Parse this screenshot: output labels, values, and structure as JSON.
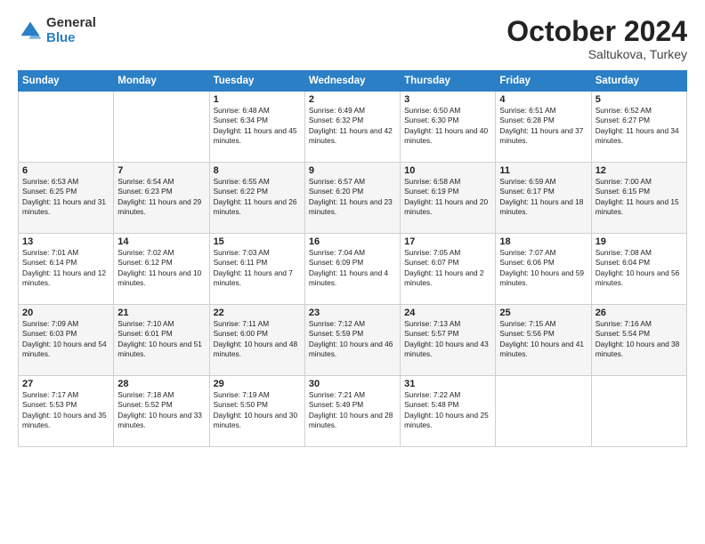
{
  "header": {
    "logo_general": "General",
    "logo_blue": "Blue",
    "month_title": "October 2024",
    "location": "Saltukova, Turkey"
  },
  "weekdays": [
    "Sunday",
    "Monday",
    "Tuesday",
    "Wednesday",
    "Thursday",
    "Friday",
    "Saturday"
  ],
  "weeks": [
    [
      {
        "day": "",
        "sunrise": "",
        "sunset": "",
        "daylight": ""
      },
      {
        "day": "",
        "sunrise": "",
        "sunset": "",
        "daylight": ""
      },
      {
        "day": "1",
        "sunrise": "Sunrise: 6:48 AM",
        "sunset": "Sunset: 6:34 PM",
        "daylight": "Daylight: 11 hours and 45 minutes."
      },
      {
        "day": "2",
        "sunrise": "Sunrise: 6:49 AM",
        "sunset": "Sunset: 6:32 PM",
        "daylight": "Daylight: 11 hours and 42 minutes."
      },
      {
        "day": "3",
        "sunrise": "Sunrise: 6:50 AM",
        "sunset": "Sunset: 6:30 PM",
        "daylight": "Daylight: 11 hours and 40 minutes."
      },
      {
        "day": "4",
        "sunrise": "Sunrise: 6:51 AM",
        "sunset": "Sunset: 6:28 PM",
        "daylight": "Daylight: 11 hours and 37 minutes."
      },
      {
        "day": "5",
        "sunrise": "Sunrise: 6:52 AM",
        "sunset": "Sunset: 6:27 PM",
        "daylight": "Daylight: 11 hours and 34 minutes."
      }
    ],
    [
      {
        "day": "6",
        "sunrise": "Sunrise: 6:53 AM",
        "sunset": "Sunset: 6:25 PM",
        "daylight": "Daylight: 11 hours and 31 minutes."
      },
      {
        "day": "7",
        "sunrise": "Sunrise: 6:54 AM",
        "sunset": "Sunset: 6:23 PM",
        "daylight": "Daylight: 11 hours and 29 minutes."
      },
      {
        "day": "8",
        "sunrise": "Sunrise: 6:55 AM",
        "sunset": "Sunset: 6:22 PM",
        "daylight": "Daylight: 11 hours and 26 minutes."
      },
      {
        "day": "9",
        "sunrise": "Sunrise: 6:57 AM",
        "sunset": "Sunset: 6:20 PM",
        "daylight": "Daylight: 11 hours and 23 minutes."
      },
      {
        "day": "10",
        "sunrise": "Sunrise: 6:58 AM",
        "sunset": "Sunset: 6:19 PM",
        "daylight": "Daylight: 11 hours and 20 minutes."
      },
      {
        "day": "11",
        "sunrise": "Sunrise: 6:59 AM",
        "sunset": "Sunset: 6:17 PM",
        "daylight": "Daylight: 11 hours and 18 minutes."
      },
      {
        "day": "12",
        "sunrise": "Sunrise: 7:00 AM",
        "sunset": "Sunset: 6:15 PM",
        "daylight": "Daylight: 11 hours and 15 minutes."
      }
    ],
    [
      {
        "day": "13",
        "sunrise": "Sunrise: 7:01 AM",
        "sunset": "Sunset: 6:14 PM",
        "daylight": "Daylight: 11 hours and 12 minutes."
      },
      {
        "day": "14",
        "sunrise": "Sunrise: 7:02 AM",
        "sunset": "Sunset: 6:12 PM",
        "daylight": "Daylight: 11 hours and 10 minutes."
      },
      {
        "day": "15",
        "sunrise": "Sunrise: 7:03 AM",
        "sunset": "Sunset: 6:11 PM",
        "daylight": "Daylight: 11 hours and 7 minutes."
      },
      {
        "day": "16",
        "sunrise": "Sunrise: 7:04 AM",
        "sunset": "Sunset: 6:09 PM",
        "daylight": "Daylight: 11 hours and 4 minutes."
      },
      {
        "day": "17",
        "sunrise": "Sunrise: 7:05 AM",
        "sunset": "Sunset: 6:07 PM",
        "daylight": "Daylight: 11 hours and 2 minutes."
      },
      {
        "day": "18",
        "sunrise": "Sunrise: 7:07 AM",
        "sunset": "Sunset: 6:06 PM",
        "daylight": "Daylight: 10 hours and 59 minutes."
      },
      {
        "day": "19",
        "sunrise": "Sunrise: 7:08 AM",
        "sunset": "Sunset: 6:04 PM",
        "daylight": "Daylight: 10 hours and 56 minutes."
      }
    ],
    [
      {
        "day": "20",
        "sunrise": "Sunrise: 7:09 AM",
        "sunset": "Sunset: 6:03 PM",
        "daylight": "Daylight: 10 hours and 54 minutes."
      },
      {
        "day": "21",
        "sunrise": "Sunrise: 7:10 AM",
        "sunset": "Sunset: 6:01 PM",
        "daylight": "Daylight: 10 hours and 51 minutes."
      },
      {
        "day": "22",
        "sunrise": "Sunrise: 7:11 AM",
        "sunset": "Sunset: 6:00 PM",
        "daylight": "Daylight: 10 hours and 48 minutes."
      },
      {
        "day": "23",
        "sunrise": "Sunrise: 7:12 AM",
        "sunset": "Sunset: 5:59 PM",
        "daylight": "Daylight: 10 hours and 46 minutes."
      },
      {
        "day": "24",
        "sunrise": "Sunrise: 7:13 AM",
        "sunset": "Sunset: 5:57 PM",
        "daylight": "Daylight: 10 hours and 43 minutes."
      },
      {
        "day": "25",
        "sunrise": "Sunrise: 7:15 AM",
        "sunset": "Sunset: 5:56 PM",
        "daylight": "Daylight: 10 hours and 41 minutes."
      },
      {
        "day": "26",
        "sunrise": "Sunrise: 7:16 AM",
        "sunset": "Sunset: 5:54 PM",
        "daylight": "Daylight: 10 hours and 38 minutes."
      }
    ],
    [
      {
        "day": "27",
        "sunrise": "Sunrise: 7:17 AM",
        "sunset": "Sunset: 5:53 PM",
        "daylight": "Daylight: 10 hours and 35 minutes."
      },
      {
        "day": "28",
        "sunrise": "Sunrise: 7:18 AM",
        "sunset": "Sunset: 5:52 PM",
        "daylight": "Daylight: 10 hours and 33 minutes."
      },
      {
        "day": "29",
        "sunrise": "Sunrise: 7:19 AM",
        "sunset": "Sunset: 5:50 PM",
        "daylight": "Daylight: 10 hours and 30 minutes."
      },
      {
        "day": "30",
        "sunrise": "Sunrise: 7:21 AM",
        "sunset": "Sunset: 5:49 PM",
        "daylight": "Daylight: 10 hours and 28 minutes."
      },
      {
        "day": "31",
        "sunrise": "Sunrise: 7:22 AM",
        "sunset": "Sunset: 5:48 PM",
        "daylight": "Daylight: 10 hours and 25 minutes."
      },
      {
        "day": "",
        "sunrise": "",
        "sunset": "",
        "daylight": ""
      },
      {
        "day": "",
        "sunrise": "",
        "sunset": "",
        "daylight": ""
      }
    ]
  ]
}
